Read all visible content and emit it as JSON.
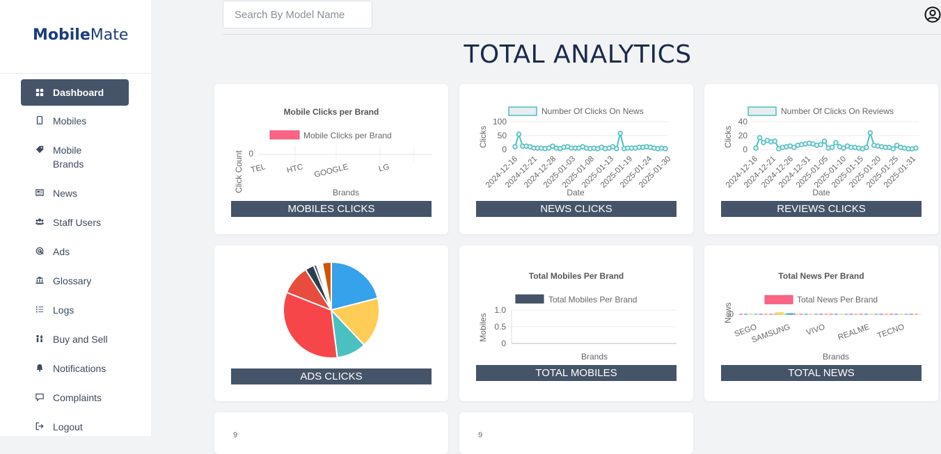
{
  "app": {
    "logo_bold": "Mobile",
    "logo_light": "Mate"
  },
  "sidebar": {
    "items": [
      {
        "label": "Dashboard",
        "icon": "grid-icon",
        "active": true
      },
      {
        "label": "Mobiles",
        "icon": "phone-icon"
      },
      {
        "label": "Mobile Brands",
        "icon": "tag-icon"
      },
      {
        "label": "News",
        "icon": "newspaper-icon"
      },
      {
        "label": "Staff Users",
        "icon": "users-icon"
      },
      {
        "label": "Ads",
        "icon": "ad-icon"
      },
      {
        "label": "Glossary",
        "icon": "bank-icon"
      },
      {
        "label": "Logs",
        "icon": "list-icon"
      },
      {
        "label": "Buy and Sell",
        "icon": "buy-sell-icon"
      },
      {
        "label": "Notifications",
        "icon": "bell-icon"
      },
      {
        "label": "Complaints",
        "icon": "comment-icon"
      },
      {
        "label": "Logout",
        "icon": "logout-icon"
      }
    ]
  },
  "header": {
    "search_placeholder": "Search By Model Name",
    "title": "TOTAL ANALYTICS"
  },
  "cards": {
    "mobiles_clicks": "MOBILES CLICKS",
    "news_clicks": "NEWS CLICKS",
    "reviews_clicks": "REVIEWS CLICKS",
    "ads_clicks": "ADS CLICKS",
    "total_mobiles": "TOTAL MOBILES",
    "total_news": "TOTAL NEWS"
  },
  "chart_data": [
    {
      "type": "bar",
      "title": "Mobile Clicks per Brand",
      "legend": "Mobile Clicks per Brand",
      "xlabel": "Brands",
      "ylabel": "Click Count",
      "categories": [
        "TEL",
        "HTC",
        "GOOGLE",
        "LG"
      ],
      "values": [
        0,
        0,
        0,
        0
      ],
      "yticks": [
        "0"
      ],
      "color": "#ff6384"
    },
    {
      "type": "line",
      "legend": "Number Of Clicks On News",
      "xlabel": "Date",
      "ylabel": "Clicks",
      "ylim": [
        0,
        100
      ],
      "yticks": [
        "100",
        "50",
        "0"
      ],
      "xticks": [
        "2024-12-16",
        "2024-12-21",
        "2024-12-28",
        "2025-01-03",
        "2025-01-08",
        "2025-01-13",
        "2025-01-19",
        "2025-01-24",
        "2025-01-30"
      ],
      "values": [
        10,
        55,
        12,
        12,
        10,
        5,
        5,
        5,
        3,
        5,
        12,
        5,
        3,
        8,
        10,
        5,
        5,
        5,
        10,
        5,
        3,
        5,
        3,
        8,
        3,
        5,
        10,
        3,
        58,
        3,
        5,
        5,
        5,
        8,
        8,
        10,
        8,
        5,
        3,
        5,
        3
      ],
      "color": "#4bc0c0"
    },
    {
      "type": "line",
      "legend": "Number Of Clicks On Reviews",
      "xlabel": "Date",
      "ylabel": "Clicks",
      "ylim": [
        0,
        40
      ],
      "yticks": [
        "40",
        "20",
        "0"
      ],
      "xticks": [
        "2024-12-16",
        "2024-12-21",
        "2024-12-26",
        "2024-12-31",
        "2025-01-05",
        "2025-01-10",
        "2025-01-15",
        "2025-01-20",
        "2025-01-25",
        "2025-01-31"
      ],
      "values": [
        2,
        17,
        10,
        13,
        11,
        12,
        1,
        3,
        4,
        5,
        3,
        6,
        7,
        8,
        9,
        8,
        6,
        7,
        12,
        2,
        3,
        10,
        4,
        2,
        5,
        3,
        3,
        2,
        1,
        3,
        24,
        6,
        5,
        4,
        3,
        3,
        1,
        6,
        3,
        2,
        1,
        1,
        2
      ],
      "color": "#4bc0c0"
    },
    {
      "type": "pie",
      "values": [
        21,
        17,
        10,
        33,
        10,
        3,
        1,
        2,
        3
      ],
      "colors": [
        "#36a2eb",
        "#ffcd56",
        "#4bc0c0",
        "#f7464a",
        "#e74c3c",
        "#2c3e50",
        "#455468",
        "#ffffff",
        "#d35400"
      ]
    },
    {
      "type": "bar",
      "title": "Total Mobiles Per Brand",
      "legend": "Total Mobiles Per Brand",
      "xlabel": "Brands",
      "ylabel": "Mobiles",
      "ylim": [
        0,
        1
      ],
      "yticks": [
        "1.0",
        "0.5",
        "0"
      ],
      "categories": [],
      "values": [],
      "color": "#455468"
    },
    {
      "type": "bar",
      "title": "Total News Per Brand",
      "legend": "Total News Per Brand",
      "xlabel": "Brands",
      "ylabel": "News",
      "yticks": [
        "0"
      ],
      "categories": [
        "SEGO",
        "SAMSUNG",
        "VIVO",
        "REALME",
        "TECNO"
      ],
      "values": [
        0,
        0,
        0,
        0,
        0
      ],
      "color": "#ff6384"
    }
  ],
  "bottom_cards": {
    "ytick_left": "9",
    "ytick_right": "9"
  }
}
